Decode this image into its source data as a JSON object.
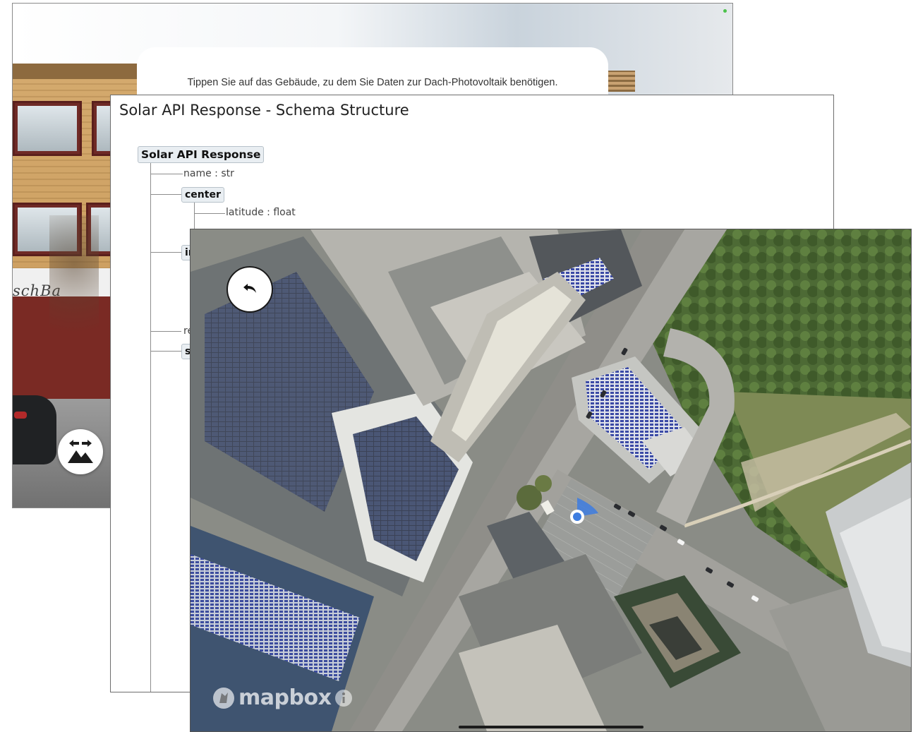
{
  "street_screen": {
    "instruction": "Tippen Sie auf das Gebäude, zu dem Sie Daten zur Dach-Photovoltaik benötigen.",
    "shop_sign": "schBa",
    "view_switch_icon": "arrows-mountain-icon"
  },
  "schema_screen": {
    "title": "Solar API Response - Schema Structure",
    "root": "Solar API Response",
    "fields": [
      {
        "label": "name : str"
      },
      {
        "label": "center"
      },
      {
        "label": "latitude : float"
      },
      {
        "label": "in"
      },
      {
        "label": "re"
      },
      {
        "label": "s"
      }
    ]
  },
  "map_screen": {
    "recenter_icon": "undo-arrow-icon",
    "attribution": "mapbox",
    "accent_color": "#3d7de0"
  }
}
